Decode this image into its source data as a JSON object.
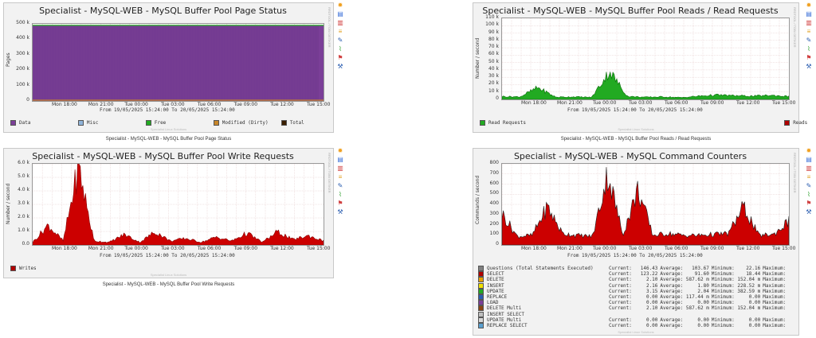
{
  "graphs": [
    {
      "id": "page_status",
      "title": "Specialist - MySQL-WEB - MySQL Buffer Pool Page Status",
      "ylabel": "Pages",
      "yticks": [
        "500 k",
        "400 k",
        "300 k",
        "200 k",
        "100 k",
        "0"
      ],
      "xticks": [
        "Mon 18:00",
        "Mon 21:00",
        "Tue 00:00",
        "Tue 03:00",
        "Tue 06:00",
        "Tue 09:00",
        "Tue 12:00",
        "Tue 15:00"
      ],
      "range": "From 19/05/2025 15:24:00 To 20/05/2025 15:24:00",
      "legend": [
        {
          "label": "Data",
          "color": "#7b3f98"
        },
        {
          "label": "Misc",
          "color": "#8fb3d9"
        },
        {
          "label": "Free",
          "color": "#22aa22"
        },
        {
          "label": "Modified (Dirty)",
          "color": "#c8862a"
        },
        {
          "label": "Total",
          "color": "#3a1f00"
        }
      ],
      "brand": "Specialist Linux Solutions",
      "side_text": "RRDTOOL / TOBI OETIKER",
      "caption": "Specialist - MySQL-WEB - MySQL Buffer Pool Page Status"
    },
    {
      "id": "reads",
      "title": "Specialist - MySQL-WEB - MySQL Buffer Pool Reads / Read Requests",
      "ylabel": "Number / second",
      "yticks": [
        "110 k",
        "100 k",
        "90 k",
        "80 k",
        "70 k",
        "60 k",
        "50 k",
        "40 k",
        "30 k",
        "20 k",
        "10 k",
        "0"
      ],
      "xticks": [
        "Mon 18:00",
        "Mon 21:00",
        "Tue 00:00",
        "Tue 03:00",
        "Tue 06:00",
        "Tue 09:00",
        "Tue 12:00",
        "Tue 15:00"
      ],
      "range": "From 19/05/2025 15:24:00 To 20/05/2025 15:24:00",
      "legend": [
        {
          "label": "Read Requests",
          "color": "#22aa22"
        },
        {
          "label": "Reads",
          "color": "#b00000"
        }
      ],
      "brand": "Specialist Linux Solutions",
      "side_text": "RRDTOOL / TOBI OETIKER",
      "caption": "Specialist - MySQL-WEB - MySQL Buffer Pool Reads / Read Requests"
    },
    {
      "id": "writes",
      "title": "Specialist - MySQL-WEB - MySQL Buffer Pool Write Requests",
      "ylabel": "Number / second",
      "yticks": [
        "6.0 k",
        "5.0 k",
        "4.0 k",
        "3.0 k",
        "2.0 k",
        "1.0 k",
        "0.0"
      ],
      "xticks": [
        "Mon 18:00",
        "Mon 21:00",
        "Tue 00:00",
        "Tue 03:00",
        "Tue 06:00",
        "Tue 09:00",
        "Tue 12:00",
        "Tue 15:00"
      ],
      "range": "From 19/05/2025 15:24:00 To 20/05/2025 15:24:00",
      "legend": [
        {
          "label": "Writes",
          "color": "#b00000"
        }
      ],
      "brand": "Specialist Linux Solutions",
      "side_text": "RRDTOOL / TOBI OETIKER",
      "caption": "Specialist - MySQL-WEB - MySQL Buffer Pool Write Requests"
    },
    {
      "id": "commands",
      "title": "Specialist - MySQL-WEB - MySQL Command Counters",
      "ylabel": "Commands / second",
      "yticks": [
        "800",
        "700",
        "600",
        "500",
        "400",
        "300",
        "200",
        "100",
        "0"
      ],
      "xticks": [
        "Mon 18:00",
        "Mon 21:00",
        "Tue 00:00",
        "Tue 03:00",
        "Tue 06:00",
        "Tue 09:00",
        "Tue 12:00",
        "Tue 15:00"
      ],
      "range": "From 19/05/2025 15:24:00 To 20/05/2025 15:24:00",
      "brand": "Specialist Linux Solutions",
      "side_text": "RRDTOOL / TOBI OETIKER",
      "caption": ""
    }
  ],
  "command_stats": [
    {
      "label": "Questions (Total Statements Executed)",
      "color": "#7f7f7f",
      "cur": "146.43",
      "avg": "103.67",
      "min": "22.16",
      "max": ""
    },
    {
      "label": "SELECT",
      "color": "#b00000",
      "cur": "123.22",
      "avg": "91.60",
      "min": "18.44",
      "max": ""
    },
    {
      "label": "DELETE",
      "color": "#e8a000",
      "cur": "2.10",
      "avg": "587.62 m",
      "min": "152.04 m",
      "max": ""
    },
    {
      "label": "INSERT",
      "color": "#f0e000",
      "cur": "2.16",
      "avg": "1.80",
      "min": "228.52 m",
      "max": ""
    },
    {
      "label": "UPDATE",
      "color": "#22aa22",
      "cur": "3.15",
      "avg": "2.04",
      "min": "382.59 m",
      "max": ""
    },
    {
      "label": "REPLACE",
      "color": "#2a5db0",
      "cur": "0.00",
      "avg": "117.44 m",
      "min": "0.00",
      "max": ""
    },
    {
      "label": "LOAD",
      "color": "#7b3f98",
      "cur": "0.00",
      "avg": "0.00",
      "min": "0.00",
      "max": ""
    },
    {
      "label": "DELETE Multi",
      "color": "#8b4513",
      "cur": "2.10",
      "avg": "587.62 m",
      "min": "152.04 m",
      "max": ""
    },
    {
      "label": "INSERT SELECT",
      "color": "#c0c0c0",
      "cur": "",
      "avg": "",
      "min": "",
      "max": ""
    },
    {
      "label": "UPDATE Multi",
      "color": "#d8d8d8",
      "cur": "0.00",
      "avg": "0.00",
      "min": "0.00",
      "max": ""
    },
    {
      "label": "REPLACE SELECT",
      "color": "#5aa0d0",
      "cur": "0.00",
      "avg": "0.00",
      "min": "0.00",
      "max": ""
    }
  ],
  "stat_headers": {
    "cur": "Current:",
    "avg": "Average:",
    "min": "Minimum:",
    "max": "Maximum:"
  },
  "icons": [
    "gear-icon",
    "chart-icon",
    "database-icon",
    "stack-icon",
    "edit-icon",
    "graph-icon",
    "filter-icon",
    "wrench-icon"
  ],
  "chart_data": [
    {
      "type": "area",
      "title": "Specialist - MySQL-WEB - MySQL Buffer Pool Page Status",
      "ylabel": "Pages",
      "ylim": [
        0,
        520000
      ],
      "series": [
        {
          "name": "Data",
          "values": [
            510000
          ]
        },
        {
          "name": "Free",
          "values": [
            2000
          ]
        },
        {
          "name": "Total",
          "values": [
            512000
          ]
        }
      ]
    },
    {
      "type": "area",
      "title": "Specialist - MySQL-WEB - MySQL Buffer Pool Reads / Read Requests",
      "ylabel": "Number / second",
      "ylim": [
        0,
        110000
      ],
      "series": [
        {
          "name": "Read Requests",
          "values": [
            4000,
            3500,
            16000,
            3000,
            3500,
            2800,
            38000,
            4000,
            3000,
            3500,
            2500,
            4500,
            6000,
            5000,
            4500,
            5500,
            4000
          ]
        }
      ]
    },
    {
      "type": "area",
      "title": "Specialist - MySQL-WEB - MySQL Buffer Pool Write Requests",
      "ylabel": "Number / second",
      "ylim": [
        0,
        6200
      ],
      "series": [
        {
          "name": "Writes",
          "values": [
            200,
            1500,
            300,
            6000,
            300,
            200,
            800,
            200,
            1000,
            300,
            500,
            200,
            600,
            300,
            900,
            200,
            1000,
            400,
            700,
            300
          ]
        }
      ]
    },
    {
      "type": "area",
      "title": "Specialist - MySQL-WEB - MySQL Command Counters",
      "ylabel": "Commands / second",
      "ylim": [
        0,
        850
      ],
      "series": [
        {
          "name": "SELECT",
          "values": [
            330,
            90,
            100,
            400,
            120,
            100,
            90,
            750,
            110,
            580,
            100,
            120,
            100,
            100,
            110,
            120,
            400,
            100,
            110,
            250
          ]
        }
      ]
    }
  ]
}
